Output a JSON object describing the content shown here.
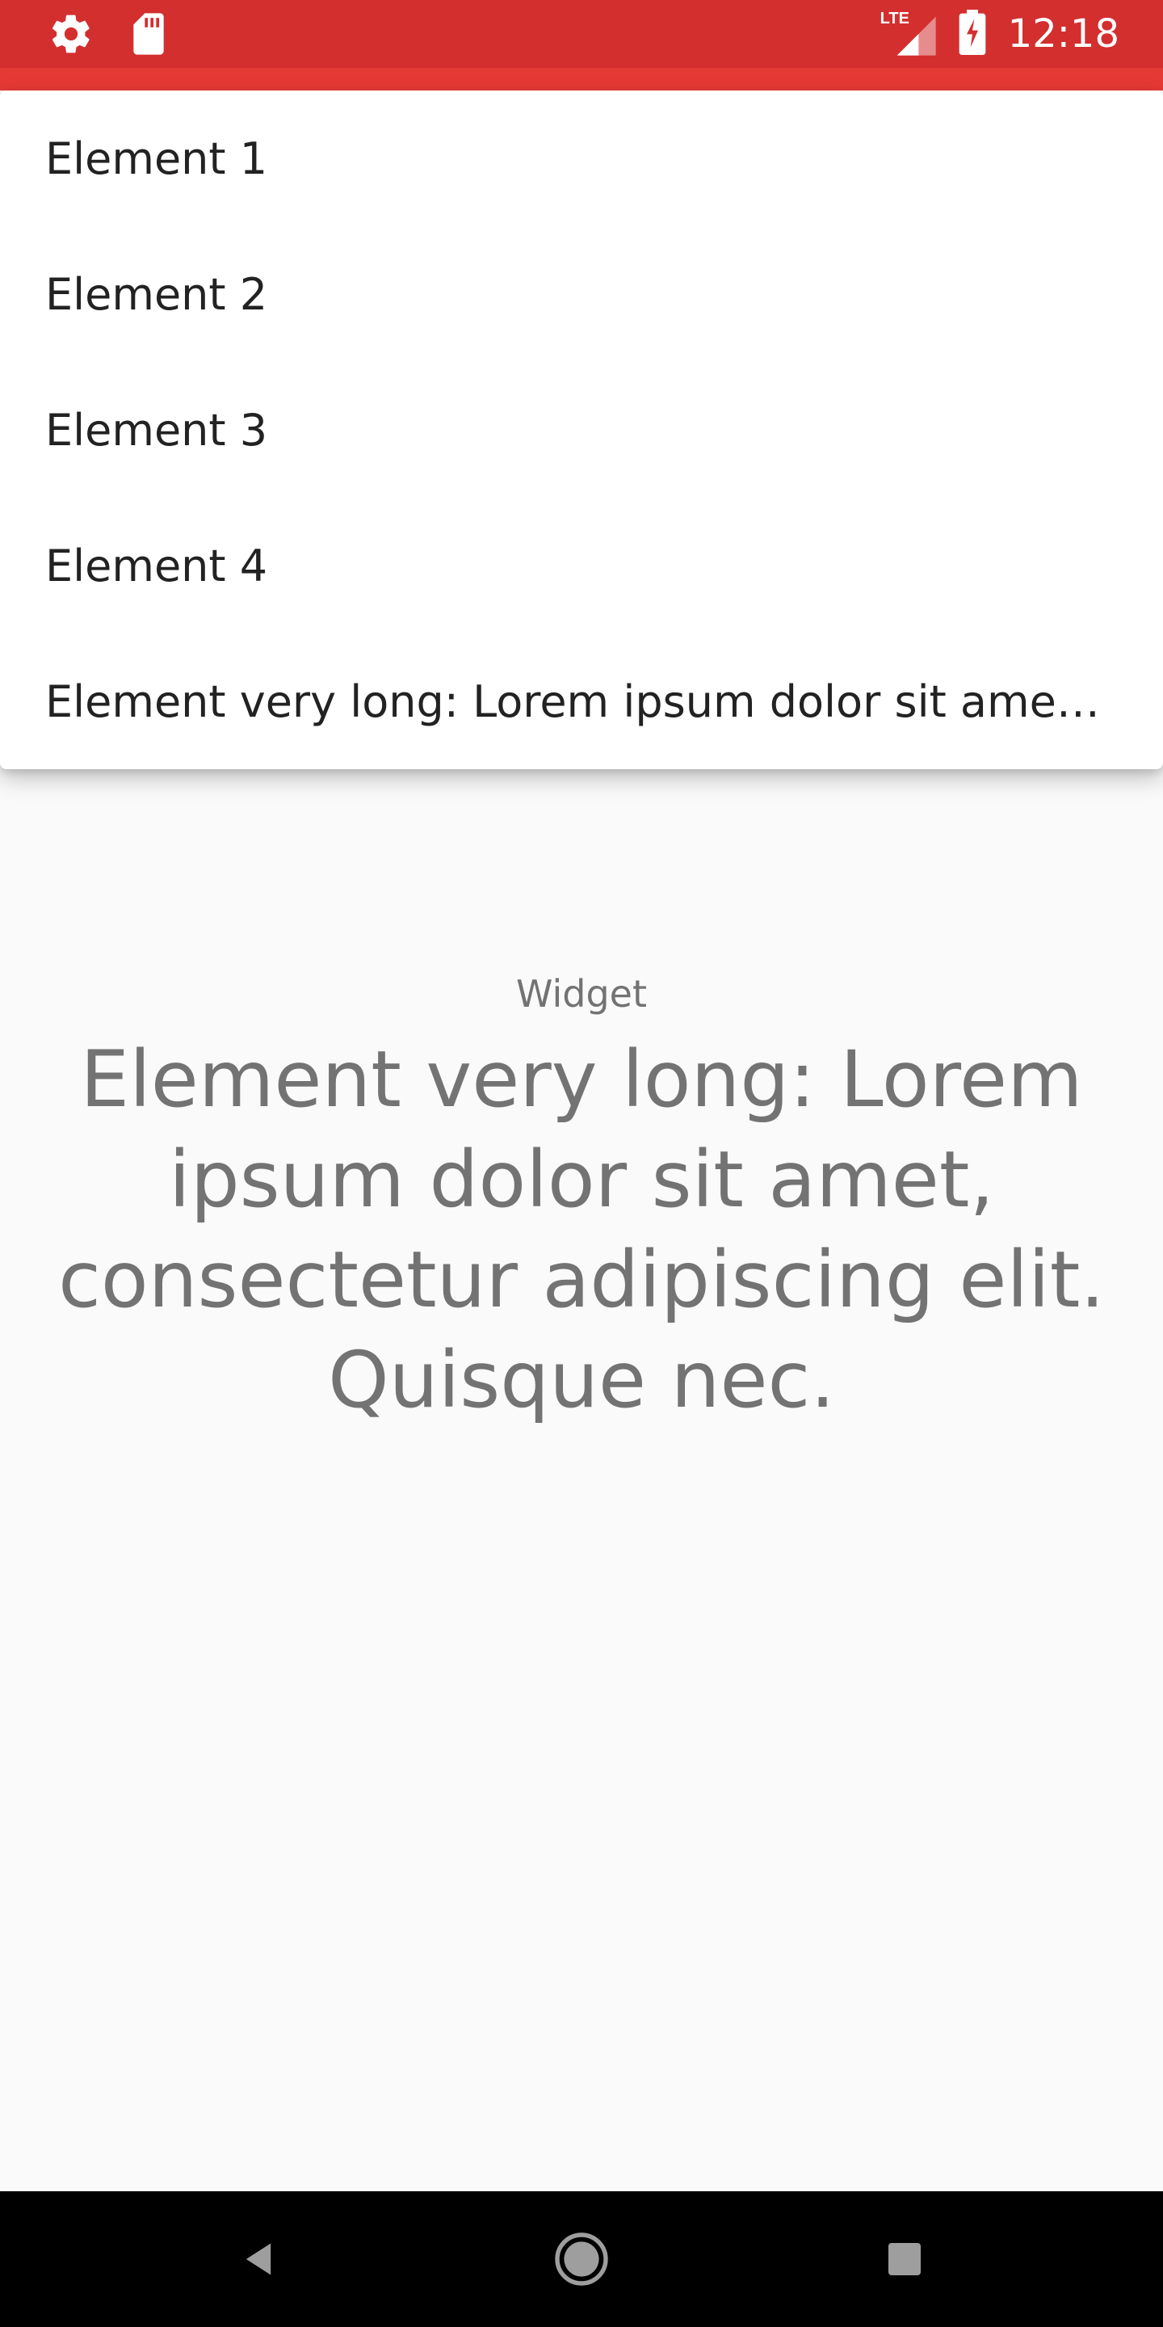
{
  "status_bar": {
    "time": "12:18",
    "network": "LTE",
    "icons": [
      "gear-icon",
      "sd-card-icon",
      "lte-signal-icon",
      "battery-charging-icon"
    ],
    "color": "#d32f2f"
  },
  "dropdown": {
    "items": [
      {
        "label": "Element 1"
      },
      {
        "label": "Element 2"
      },
      {
        "label": "Element 3"
      },
      {
        "label": "Element 4"
      },
      {
        "label": "Element very long: Lorem ipsum dolor sit amet, consectetur adipiscing elit. Quisque nec."
      }
    ]
  },
  "widget": {
    "label": "Widget",
    "value": "Element very long: Lorem ipsum dolor sit amet, consectetur adipiscing elit. Quisque nec."
  },
  "nav_bar": {
    "buttons": [
      "back-icon",
      "home-icon",
      "recents-icon"
    ]
  }
}
